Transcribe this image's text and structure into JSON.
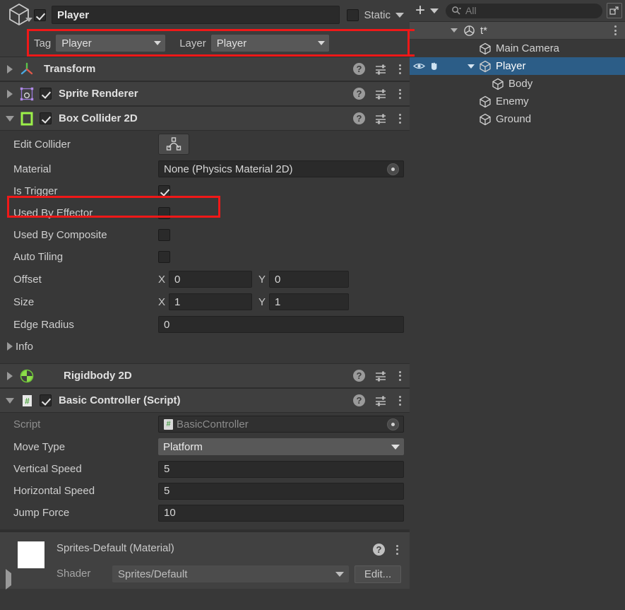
{
  "inspector": {
    "game_object": {
      "icon": "cube-icon",
      "enabled": true,
      "name": "Player",
      "static_label": "Static",
      "static_checked": false,
      "tag_label": "Tag",
      "tag_value": "Player",
      "layer_label": "Layer",
      "layer_value": "Player"
    },
    "components": [
      {
        "id": "transform",
        "title": "Transform",
        "icon": "transform-axis-icon",
        "expanded": false,
        "has_enable_checkbox": false
      },
      {
        "id": "sprite-renderer",
        "title": "Sprite Renderer",
        "icon": "sprite-renderer-icon",
        "expanded": false,
        "has_enable_checkbox": true,
        "enabled": true
      },
      {
        "id": "box-collider-2d",
        "title": "Box Collider 2D",
        "icon": "box-collider-2d-icon",
        "expanded": true,
        "has_enable_checkbox": true,
        "enabled": true,
        "properties": {
          "edit_collider_label": "Edit Collider",
          "edit_collider_button_icon": "polygon-edit-icon",
          "material_label": "Material",
          "material_value": "None (Physics Material 2D)",
          "is_trigger_label": "Is Trigger",
          "is_trigger_checked": true,
          "used_by_effector_label": "Used By Effector",
          "used_by_effector_checked": false,
          "used_by_composite_label": "Used By Composite",
          "used_by_composite_checked": false,
          "auto_tiling_label": "Auto Tiling",
          "auto_tiling_checked": false,
          "offset_label": "Offset",
          "offset_x_axis": "X",
          "offset_x": "0",
          "offset_y_axis": "Y",
          "offset_y": "0",
          "size_label": "Size",
          "size_x_axis": "X",
          "size_x": "1",
          "size_y_axis": "Y",
          "size_y": "1",
          "edge_radius_label": "Edge Radius",
          "edge_radius": "0",
          "info_label": "Info"
        }
      },
      {
        "id": "rigidbody-2d",
        "title": "Rigidbody 2D",
        "icon": "rigidbody-2d-icon",
        "expanded": false,
        "has_enable_checkbox": false
      },
      {
        "id": "basic-controller",
        "title": "Basic Controller (Script)",
        "icon": "cs-script-icon",
        "expanded": true,
        "has_enable_checkbox": true,
        "enabled": true,
        "properties": {
          "script_label": "Script",
          "script_value": "BasicController",
          "move_type_label": "Move Type",
          "move_type_value": "Platform",
          "vertical_speed_label": "Vertical Speed",
          "vertical_speed": "5",
          "horizontal_speed_label": "Horizontal Speed",
          "horizontal_speed": "5",
          "jump_force_label": "Jump Force",
          "jump_force": "10"
        }
      }
    ],
    "material_preview": {
      "title": "Sprites-Default (Material)",
      "swatch_color": "#ffffff",
      "shader_label": "Shader",
      "shader_value": "Sprites/Default",
      "edit_button_label": "Edit..."
    },
    "highlight_color": "#f01818"
  },
  "hierarchy": {
    "toolbar": {
      "add_icon": "plus-icon",
      "add_caret_icon": "chevron-down-icon",
      "search_icon": "search-icon",
      "search_placeholder": "All",
      "search_value": "",
      "expand_icon": "expand-panel-icon"
    },
    "scene": {
      "icon": "unity-scene-icon",
      "name": "t*",
      "expanded": true,
      "menu_icon": "kebab-menu-icon"
    },
    "items": [
      {
        "name": "Main Camera",
        "depth": 1,
        "selected": false,
        "expandable": false,
        "visibility_icons": false
      },
      {
        "name": "Player",
        "depth": 1,
        "selected": true,
        "expandable": true,
        "visibility_icons": true
      },
      {
        "name": "Body",
        "depth": 2,
        "selected": false,
        "expandable": false,
        "visibility_icons": false
      },
      {
        "name": "Enemy",
        "depth": 1,
        "selected": false,
        "expandable": false,
        "visibility_icons": false
      },
      {
        "name": "Ground",
        "depth": 1,
        "selected": false,
        "expandable": false,
        "visibility_icons": false
      }
    ],
    "selection_color": "#2c5d87"
  }
}
